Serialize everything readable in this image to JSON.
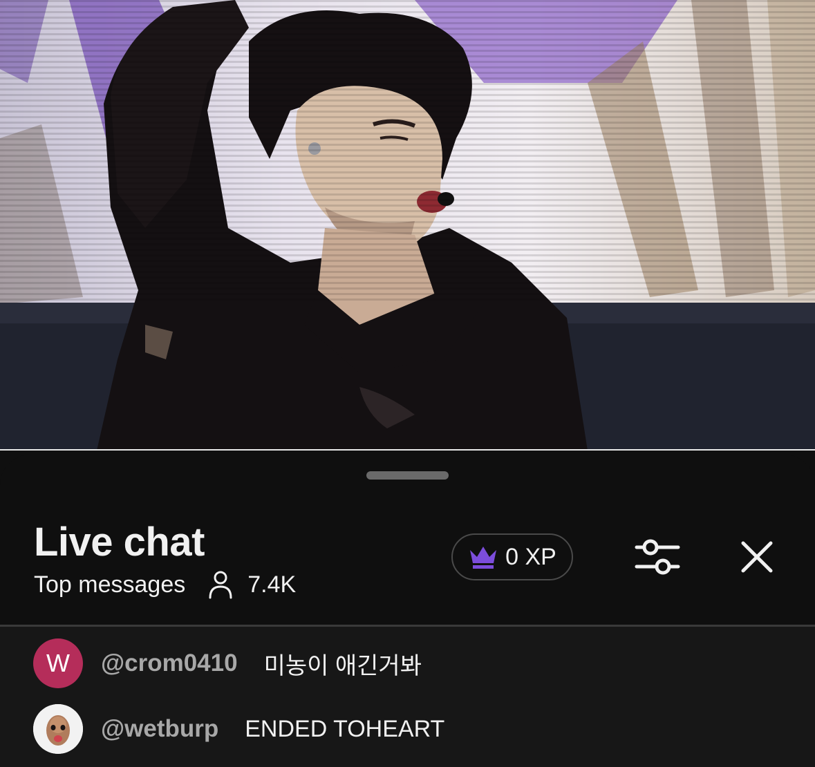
{
  "video": {
    "progress_fraction": 1.0
  },
  "chat": {
    "title": "Live chat",
    "mode": "Top messages",
    "viewer_count": "7.4K",
    "xp": "0 XP",
    "icons": {
      "viewers": "person-icon",
      "xp": "crown-icon",
      "filter": "sliders-icon",
      "close": "close-icon"
    },
    "colors": {
      "crown": "#7c4ddb",
      "avatar_w": "#b52d5a",
      "background": "#0f0f0f",
      "message_area": "#171717"
    },
    "messages": [
      {
        "avatar_letter": "W",
        "author": "@crom0410",
        "text": "미농이 애긴거봐"
      },
      {
        "avatar_letter": "",
        "author": "@wetburp",
        "text": "ENDED TOHEART"
      }
    ]
  }
}
